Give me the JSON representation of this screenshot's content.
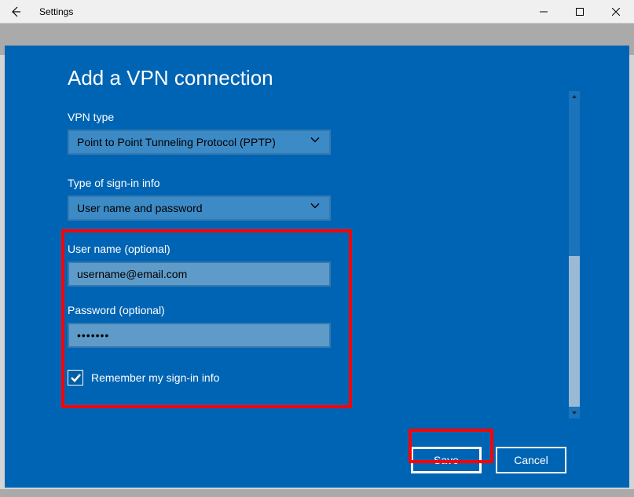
{
  "window": {
    "title": "Settings"
  },
  "dialog": {
    "title": "Add a VPN connection"
  },
  "fields": {
    "vpn_type": {
      "label": "VPN type",
      "value": "Point to Point Tunneling Protocol (PPTP)"
    },
    "signin_type": {
      "label": "Type of sign-in info",
      "value": "User name and password"
    },
    "username": {
      "label": "User name (optional)",
      "value": "username@email.com"
    },
    "password": {
      "label": "Password (optional)",
      "value": "•••••••"
    },
    "remember": {
      "label": "Remember my sign-in info",
      "checked": true
    }
  },
  "buttons": {
    "save": "Save",
    "cancel": "Cancel"
  }
}
